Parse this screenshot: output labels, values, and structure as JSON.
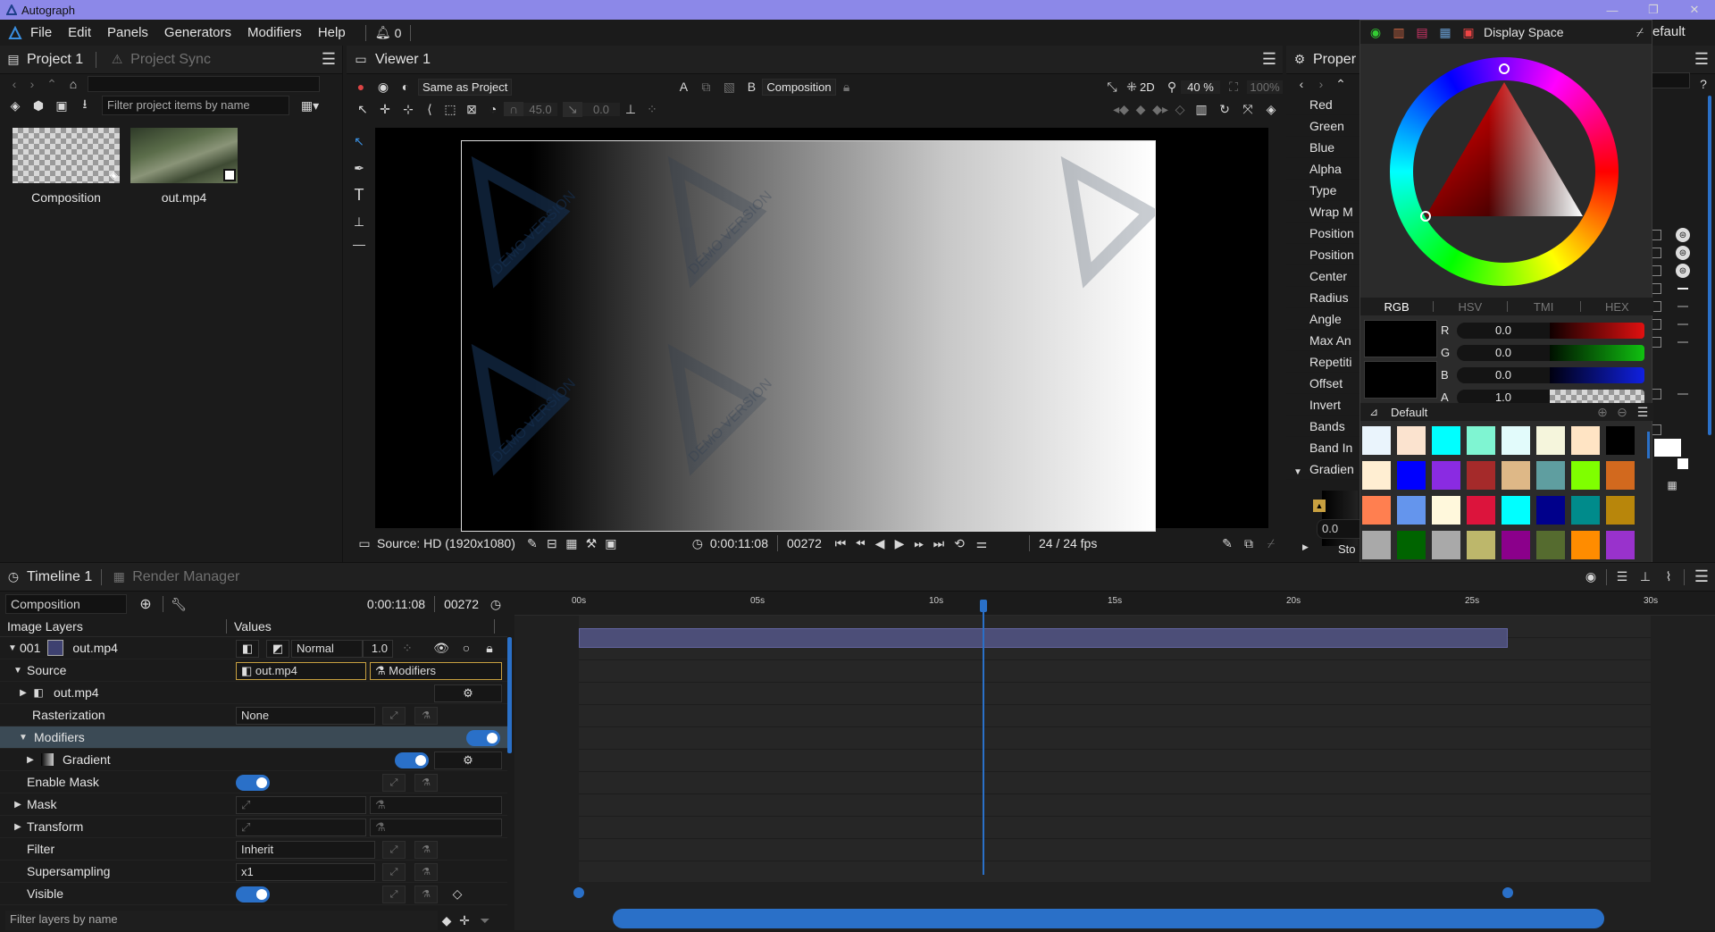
{
  "app": {
    "title": "Autograph"
  },
  "menu": [
    "File",
    "Edit",
    "Panels",
    "Generators",
    "Modifiers",
    "Help"
  ],
  "notifications": {
    "count": "0"
  },
  "project_panel": {
    "title": "Project 1",
    "sync_tab": "Project Sync",
    "filter_placeholder": "Filter project items by name",
    "items": [
      {
        "label": "Composition"
      },
      {
        "label": "out.mp4"
      }
    ]
  },
  "viewer": {
    "title": "Viewer 1",
    "color_mode": "Same as Project",
    "layer_target": "Composition",
    "view_mode": "2D",
    "zoom": "40 %",
    "zoom_max": "100%",
    "snap_angle": "45.0",
    "snap_offset": "0.0",
    "watermark": "DEMO VERSION",
    "source_label": "Source: HD (1920x1080)",
    "timecode": "0:00:11:08",
    "frame": "00272",
    "fps": "24 / 24 fps"
  },
  "properties_panel": {
    "title": "Proper",
    "rows": [
      "Red",
      "Green",
      "Blue",
      "Alpha",
      "Type",
      "Wrap M",
      "Position",
      "Position",
      "Center",
      "Radius",
      "Angle",
      "Max An",
      "Repetiti",
      "Offset",
      "Invert",
      "Bands",
      "Band In",
      "Gradien"
    ],
    "stop_label": "Sto",
    "stop_value": "0.0",
    "right_header": "efault"
  },
  "color_picker": {
    "display_space": "Display Space",
    "tabs": [
      "RGB",
      "HSV",
      "TMI",
      "HEX"
    ],
    "active_tab": "RGB",
    "channels": [
      {
        "label": "R",
        "value": "0.0",
        "color": "#e01010"
      },
      {
        "label": "G",
        "value": "0.0",
        "color": "#10c010"
      },
      {
        "label": "B",
        "value": "0.0",
        "color": "#1020e0"
      },
      {
        "label": "A",
        "value": "1.0",
        "color": "checker"
      }
    ],
    "current_color": "#000000",
    "palette_name": "Default",
    "swatches": [
      "#eaf4fc",
      "#fbe3cf",
      "#00ffff",
      "#7ff5d2",
      "#e2fbfb",
      "#f5f5dc",
      "#ffe4c4",
      "#000000",
      "#ffeed2",
      "#0000ff",
      "#8a2be2",
      "#a52a2a",
      "#deb887",
      "#5f9ea0",
      "#7fff00",
      "#d2691e",
      "#ff7f50",
      "#6495ed",
      "#fff8dc",
      "#dc143c",
      "#00ffff",
      "#00008b",
      "#008b8b",
      "#b8860b",
      "#a9a9a9",
      "#006400",
      "#a9a9a9",
      "#bdb76b",
      "#8b008b",
      "#556b2f",
      "#ff8c00",
      "#9932cc"
    ]
  },
  "timeline": {
    "title": "Timeline 1",
    "render_tab": "Render Manager",
    "comp_name": "Composition",
    "timecode": "0:00:11:08",
    "frame": "00272",
    "col_layers": "Image Layers",
    "col_values": "Values",
    "ruler_labels": [
      "00s",
      "05s",
      "10s",
      "15s",
      "20s",
      "25s",
      "30s"
    ],
    "playhead_seconds": 11.33,
    "clip_start_seconds": 0,
    "clip_end_seconds": 26,
    "ruler_end_seconds": 30,
    "filter_placeholder": "Filter layers by name",
    "rows": {
      "layer_index": "001",
      "layer_name": "out.mp4",
      "blend": "Normal",
      "opacity": "1.0",
      "source": "Source",
      "source_value": "out.mp4",
      "modifiers_btn": "Modifiers",
      "sub_source": "out.mp4",
      "rasterization": "Rasterization",
      "rasterization_value": "None",
      "modifiers": "Modifiers",
      "gradient": "Gradient",
      "enable_mask": "Enable Mask",
      "mask": "Mask",
      "transform": "Transform",
      "filter": "Filter",
      "filter_value": "Inherit",
      "supersampling": "Supersampling",
      "supersampling_value": "x1",
      "visible": "Visible"
    }
  }
}
